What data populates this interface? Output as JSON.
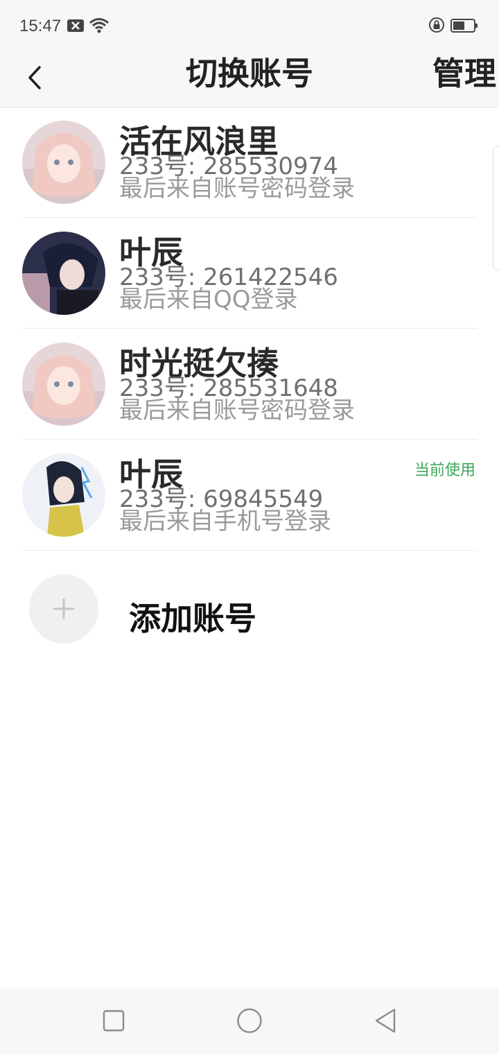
{
  "status_bar": {
    "time": "15:47",
    "icons": [
      "notification-x-icon",
      "wifi-icon",
      "rotation-lock-icon",
      "battery-icon"
    ]
  },
  "header": {
    "back_icon": "chevron-left-icon",
    "title": "切换账号",
    "manage_label": "管理"
  },
  "accounts": [
    {
      "name": "活在风浪里",
      "id_line": "233号: 285530974",
      "source": "最后来自账号密码登录",
      "current": ""
    },
    {
      "name": "叶辰",
      "id_line": "233号: 261422546",
      "source": "最后来自QQ登录",
      "current": ""
    },
    {
      "name": "时光挺欠揍",
      "id_line": "233号: 285531648",
      "source": "最后来自账号密码登录",
      "current": ""
    },
    {
      "name": "叶辰",
      "id_line": "233号: 69845549",
      "source": "最后来自手机号登录",
      "current": "当前使用"
    }
  ],
  "add_account": {
    "icon": "plus-icon",
    "label": "添加账号"
  },
  "nav_bar": {
    "icons": [
      "recent-apps-icon",
      "home-icon",
      "back-icon"
    ]
  },
  "colors": {
    "current_badge": "#3aa757",
    "background": "#ffffff",
    "bar_background": "#f7f7f7"
  }
}
